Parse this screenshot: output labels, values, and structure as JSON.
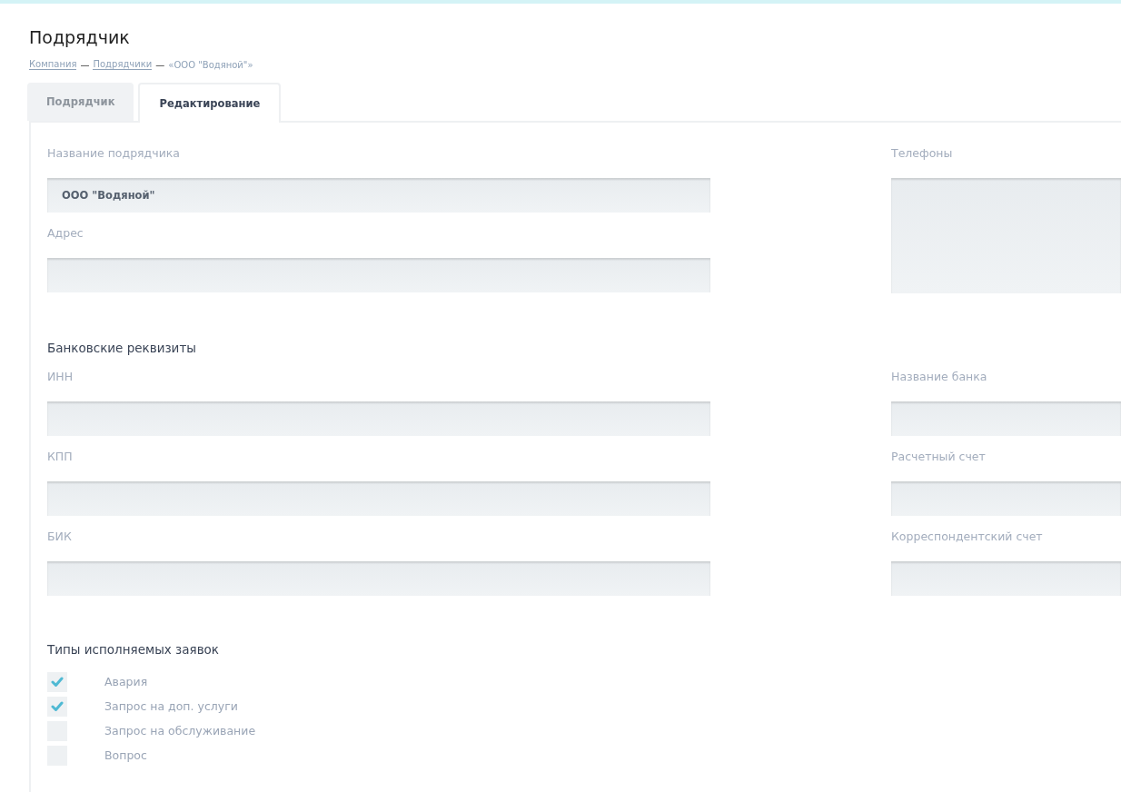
{
  "page_title": "Подрядчик",
  "breadcrumb": [
    {
      "label": "Компания",
      "kind": "link"
    },
    {
      "label": "—",
      "kind": "separator"
    },
    {
      "label": "Подрядчики",
      "kind": "link"
    },
    {
      "label": "—",
      "kind": "separator"
    },
    {
      "label": "«ООО \"Водяной\"»",
      "kind": "current"
    }
  ],
  "tabs": [
    {
      "label": "Подрядчик",
      "selected": false
    },
    {
      "label": "Редактирование",
      "selected": true
    }
  ],
  "main_fields": [
    {
      "label": "Название подрядчика",
      "value": "ООО \"Водяной\""
    },
    {
      "label": "Адрес"
    }
  ],
  "phones": {
    "label": "Телефоны"
  },
  "bank_section": {
    "title": "Банковские реквизиты",
    "left_fields": [
      {
        "label": "ИНН"
      },
      {
        "label": "КПП"
      },
      {
        "label": "БИК"
      }
    ],
    "right_fields": [
      {
        "label": "Название банка"
      },
      {
        "label": "Расчетный счет"
      },
      {
        "label": "Корреспондентский счет"
      }
    ]
  },
  "request_types": {
    "title": "Типы исполняемых заявок",
    "items": [
      {
        "label": "Авария",
        "checked": true
      },
      {
        "label": "Запрос на доп. услуги",
        "checked": true
      },
      {
        "label": "Запрос на обслуживание",
        "checked": false
      },
      {
        "label": "Вопрос",
        "checked": false
      }
    ]
  }
}
